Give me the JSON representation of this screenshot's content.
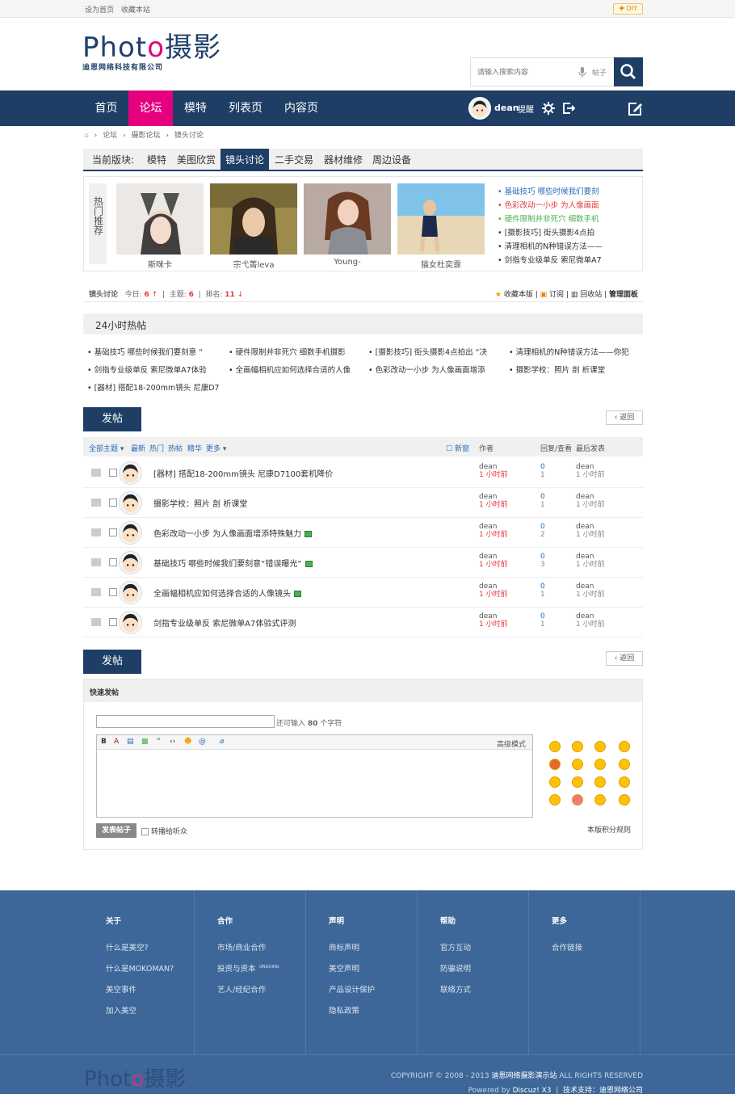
{
  "topbar": {
    "set_home": "设为首页",
    "favorite": "收藏本站",
    "diy": "DIY"
  },
  "logo": {
    "text_en_a": "Phot",
    "text_en_o": "o",
    "text_cn": "摄影",
    "company": "迪恩网络科技有限公司"
  },
  "search": {
    "placeholder": "请输入搜索内容",
    "type": "帖子"
  },
  "nav": {
    "items": [
      "首页",
      "论坛",
      "模特",
      "列表页",
      "内容页"
    ],
    "active_index": 1,
    "username": "dean",
    "remind": "提醒"
  },
  "breadcrumb": [
    "论坛",
    "摄影论坛",
    "镜头讨论"
  ],
  "boards": {
    "label": "当前版块:",
    "items": [
      "模特",
      "美图欣赏",
      "镜头讨论",
      "二手交易",
      "器材维修",
      "周边设备"
    ],
    "active_index": 2
  },
  "hot_recommend": {
    "title": "热门推荐",
    "pictures": [
      {
        "caption": "斯咪卡"
      },
      {
        "caption": "宗弋菁leva"
      },
      {
        "caption": "Young-"
      },
      {
        "caption": "猫女杜奕霏"
      }
    ],
    "links": [
      {
        "text": "基础技巧 哪些时候我们要刻",
        "color": "#2a6ab8"
      },
      {
        "text": "色彩改动一小步 为人像画面",
        "color": "#e4393c"
      },
      {
        "text": "硬件限制并非死穴 细数手机",
        "color": "#4caf50"
      },
      {
        "text": "[摄影技巧] 街头摄影4点拍",
        "color": "#333333"
      },
      {
        "text": "清理相机的N种错误方法——",
        "color": "#333333"
      },
      {
        "text": "剑指专业级单反 索尼微单A7",
        "color": "#333333"
      }
    ]
  },
  "forum_stat": {
    "name": "镜头讨论",
    "today_label": "今日:",
    "today": "6",
    "topics_label": "主题:",
    "topics": "6",
    "rank_label": "排名:",
    "rank": "11",
    "actions": [
      "收藏本版",
      "订阅",
      "回收站",
      "管理面板"
    ]
  },
  "hot24": {
    "title": "24小时热帖",
    "items": [
      "基础技巧 哪些时候我们要刻意 “",
      "硬件限制并非死穴 细数手机摄影",
      "[摄影技巧] 街头摄影4点拍出 “决",
      "清理相机的N种错误方法——你犯",
      "剑指专业级单反 索尼微单A7体验",
      "全画幅相机应如何选择合适的人像",
      "色彩改动一小步 为人像画面增添",
      "摄影学校：照片 剖 析课堂",
      "[器材] 搭配18-200mm镜头 尼康D7"
    ]
  },
  "buttons": {
    "post": "发帖",
    "back": "返回"
  },
  "thread_head": {
    "all": "全部主题",
    "latest": "最新",
    "hot": "热门",
    "hotpost": "热帖",
    "digest": "精华",
    "more": "更多",
    "new_window": "新窗",
    "author": "作者",
    "reply_view": "回复/查看",
    "last_post": "最后发表"
  },
  "threads": [
    {
      "title": "[器材] 搭配18-200mm镜头 尼康D7100套机降价",
      "image": false,
      "author": "dean",
      "time": "1 小时前",
      "replies": "0",
      "views": "1",
      "last_author": "dean",
      "last_time": "1 小时前"
    },
    {
      "title": "摄影学校：照片 剖 析课堂",
      "image": false,
      "author": "dean",
      "time": "1 小时前",
      "replies": "0",
      "views": "1",
      "last_author": "dean",
      "last_time": "1 小时前"
    },
    {
      "title": "色彩改动一小步 为人像画面增添特殊魅力",
      "image": true,
      "author": "dean",
      "time": "1 小时前",
      "replies": "0",
      "views": "2",
      "last_author": "dean",
      "last_time": "1 小时前"
    },
    {
      "title": "基础技巧 哪些时候我们要刻意“错误曝光”",
      "image": true,
      "author": "dean",
      "time": "1 小时前",
      "replies": "0",
      "views": "3",
      "last_author": "dean",
      "last_time": "1 小时前"
    },
    {
      "title": "全画幅相机应如何选择合适的人像镜头",
      "image": true,
      "author": "dean",
      "time": "1 小时前",
      "replies": "0",
      "views": "1",
      "last_author": "dean",
      "last_time": "1 小时前"
    },
    {
      "title": "剑指专业级单反 索尼微单A7体验式评测",
      "image": false,
      "author": "dean",
      "time": "1 小时前",
      "replies": "0",
      "views": "1",
      "last_author": "dean",
      "last_time": "1 小时前"
    }
  ],
  "quick_post": {
    "title": "快速发帖",
    "remain_a": "还可输入",
    "remain_n": "80",
    "remain_b": "个字符",
    "advanced": "高级模式",
    "submit": "发表帖子",
    "share": "转播给听众",
    "rule": "本版积分规则"
  },
  "footer": {
    "columns": [
      {
        "title": "关于",
        "links": [
          "什么是美空?",
          "什么是MOKOMAN?",
          "美空事件",
          "加入美空"
        ]
      },
      {
        "title": "合作",
        "links": [
          "市场/商业合作",
          "投资与资本",
          "艺人/经纪合作"
        ],
        "badge": "ONGOING"
      },
      {
        "title": "声明",
        "links": [
          "商标声明",
          "美空声明",
          "产品设计保护",
          "隐私政策"
        ]
      },
      {
        "title": "帮助",
        "links": [
          "官方互动",
          "防骗说明",
          "联络方式"
        ]
      },
      {
        "title": "更多",
        "links": [
          "合作链接"
        ]
      }
    ],
    "copyright_a": "COPYRIGHT © 2008 - 2013",
    "site": "迪恩网络摄影演示站",
    "copyright_b": "ALL RIGHTS RESERVED",
    "powered_a": "Powered by",
    "discuz": "Discuz! X3",
    "support_label": "技术支持：",
    "support": "迪恩网络公司"
  },
  "colors": {
    "primary": "#1e3e66",
    "accent": "#e4007f",
    "footer": "#3d6798"
  }
}
